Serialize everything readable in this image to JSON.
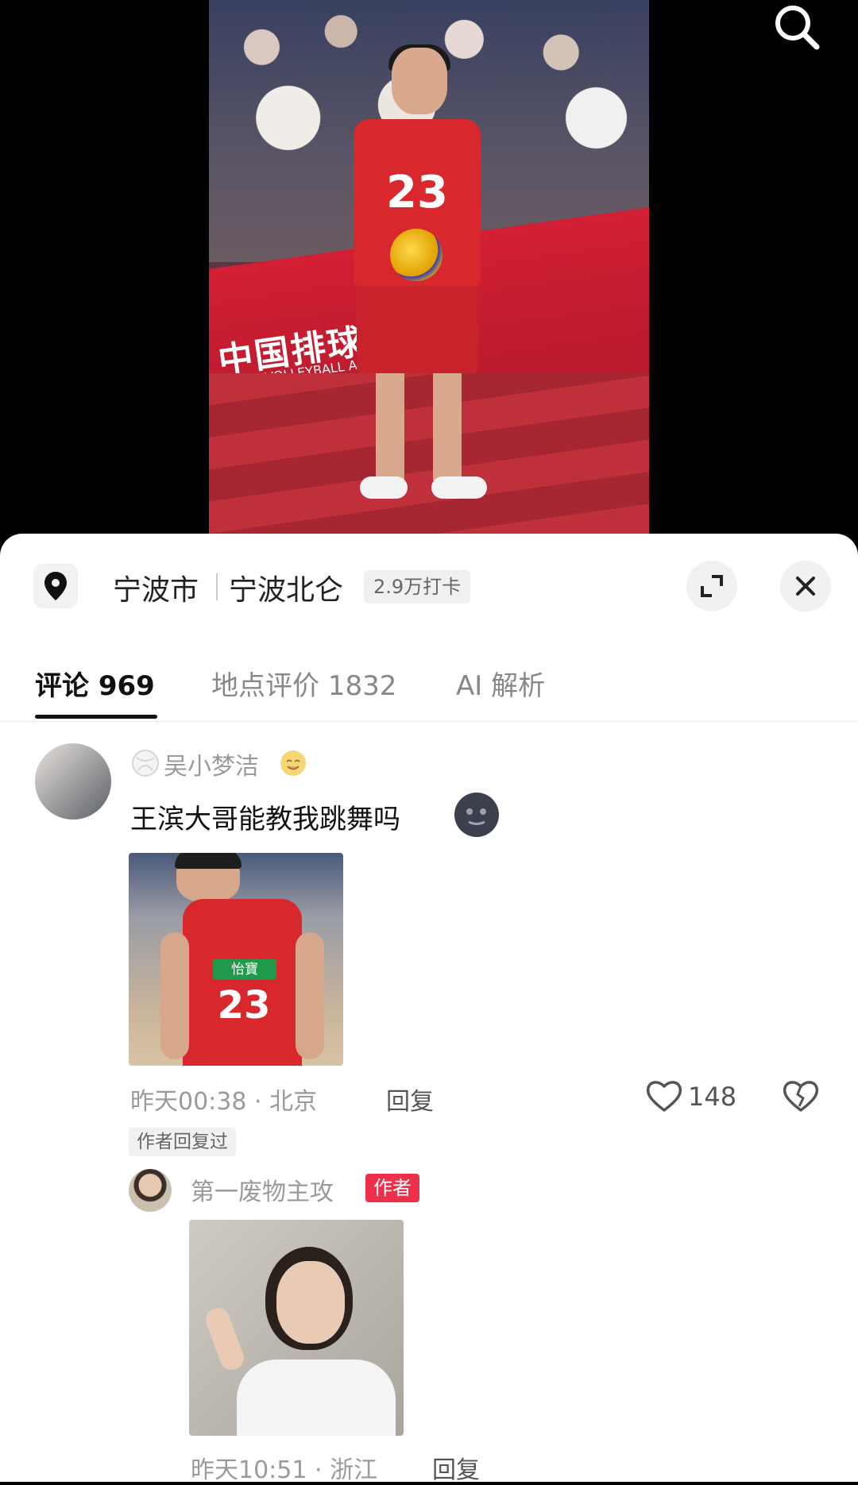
{
  "location": {
    "city": "宁波市",
    "place": "宁波北仑",
    "badge": "2.9万打卡"
  },
  "tabs": [
    {
      "label": "评论 969",
      "active": true
    },
    {
      "label": "地点评价 1832",
      "active": false
    },
    {
      "label": "AI 解析",
      "active": false
    }
  ],
  "comment": {
    "username": "吴小梦洁",
    "text": "王滨大哥能教我跳舞吗",
    "meta": "昨天00:38 · 北京",
    "reply_label": "回复",
    "likes": "148",
    "author_replied_label": "作者回复过",
    "image_number": "23",
    "image_sponsor": "怡寶"
  },
  "reply": {
    "username": "第一废物主攻",
    "author_tag": "作者",
    "meta": "昨天10:51 · 浙江",
    "reply_label": "回复"
  },
  "video": {
    "jersey_number": "23",
    "banner_text": "中国排球協會",
    "banner_subtext": "CHINA VOLLEYBALL ASSOCIATION"
  },
  "colors": {
    "accent_red": "#ee2f4a",
    "jersey_red": "#d9272e"
  }
}
